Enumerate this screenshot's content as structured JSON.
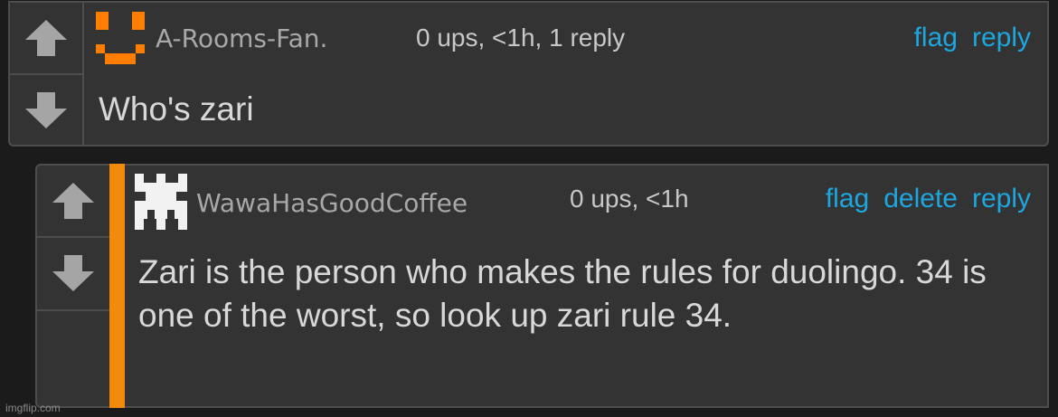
{
  "comments": [
    {
      "username": "A-Rooms-Fan.",
      "meta": "0 ups, <1h, 1 reply",
      "actions": [
        "flag",
        "reply"
      ],
      "text": "Who's zari"
    },
    {
      "username": "WawaHasGoodCoffee",
      "meta": "0 ups, <1h",
      "actions": [
        "flag",
        "delete",
        "reply"
      ],
      "text": "Zari is the person who makes the rules for duolingo. 34 is one of the worst, so look up zari rule 34."
    }
  ],
  "watermark": "imgflip.com",
  "colors": {
    "accent": "#f48a0c",
    "link": "#1da7e0",
    "panel": "#333333",
    "background": "#1b1b1b"
  },
  "icons": [
    "upvote-arrow-icon",
    "downvote-arrow-icon",
    "orange-face-avatar-icon",
    "white-glyph-avatar-icon"
  ]
}
